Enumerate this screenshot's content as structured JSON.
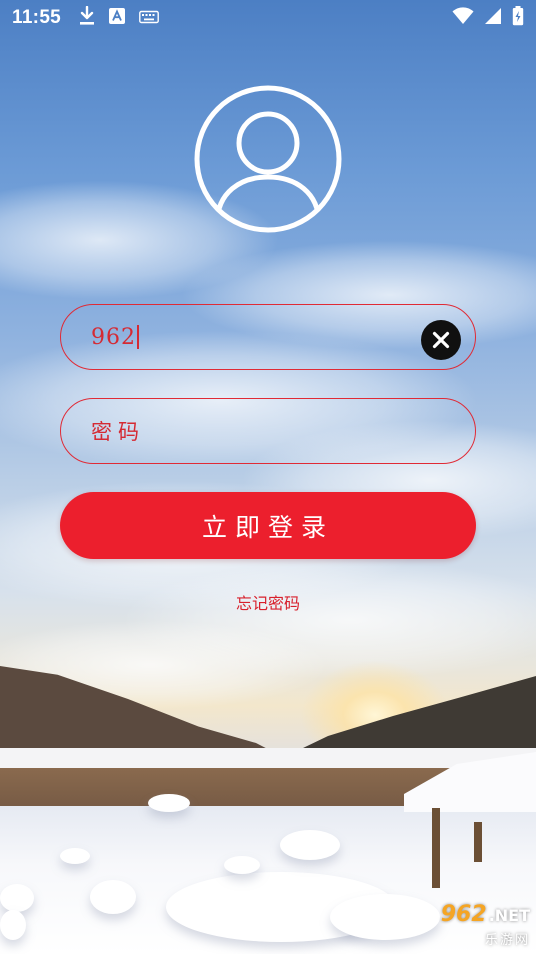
{
  "status_bar": {
    "time": "11:55",
    "left_icons": [
      "download-icon",
      "a-notification-icon",
      "keyboard-icon"
    ],
    "right_icons": [
      "wifi-icon",
      "signal-icon",
      "battery-charging-icon"
    ]
  },
  "avatar": {
    "icon": "user-avatar-icon"
  },
  "username_field": {
    "value": "962",
    "clear_icon": "clear-icon"
  },
  "password_field": {
    "placeholder": "密码"
  },
  "login_button": {
    "label": "立即登录"
  },
  "forgot_password": {
    "label": "忘记密码"
  },
  "watermark": {
    "brand_num": "962",
    "brand_suffix": ".NET",
    "site_name": "乐游网"
  },
  "colors": {
    "accent": "#ec1f2d",
    "field_border": "#e02a35",
    "text_red": "#d52a33",
    "clear_button": "#101010"
  }
}
